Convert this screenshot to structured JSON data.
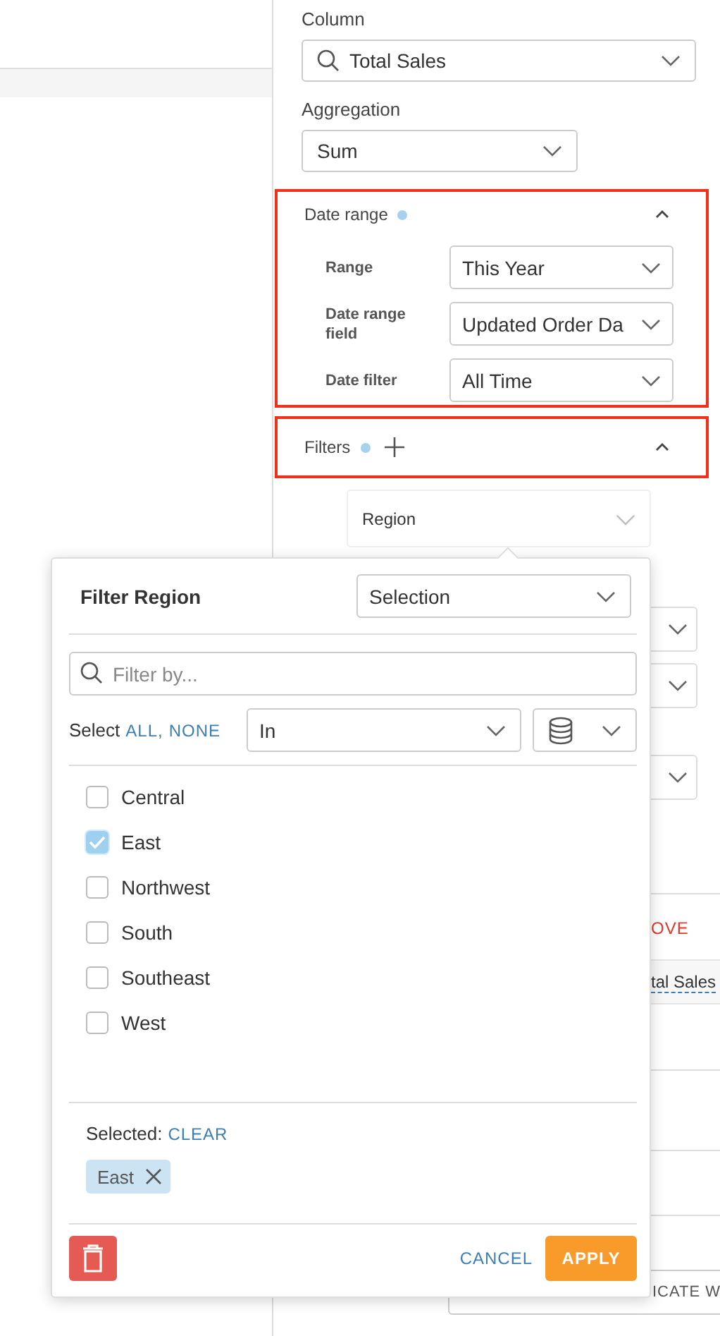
{
  "panel": {
    "column": {
      "label": "Column",
      "value": "Total Sales"
    },
    "aggregation": {
      "label": "Aggregation",
      "value": "Sum"
    },
    "date_range": {
      "title": "Date range",
      "highlighted": true,
      "has_value": true,
      "expanded": true,
      "fields": [
        {
          "label": "Range",
          "value": "This Year"
        },
        {
          "label": "Date range field",
          "value": "Updated Order Da"
        },
        {
          "label": "Date filter",
          "value": "All Time"
        }
      ]
    },
    "filters": {
      "title": "Filters",
      "highlighted": true,
      "has_value": true,
      "expanded": true,
      "items": [
        {
          "value": "Region"
        }
      ]
    },
    "remove_link": "OVE",
    "tooltip": "tal Sales",
    "duplicate_button": "ICATE W"
  },
  "popover": {
    "title": "Filter Region",
    "mode": "Selection",
    "search": {
      "placeholder": "Filter by..."
    },
    "select_label": "Select",
    "select_links": [
      "ALL,",
      "NONE"
    ],
    "operator": "In",
    "options": [
      {
        "label": "Central",
        "checked": false
      },
      {
        "label": "East",
        "checked": true
      },
      {
        "label": "Northwest",
        "checked": false
      },
      {
        "label": "South",
        "checked": false
      },
      {
        "label": "Southeast",
        "checked": false
      },
      {
        "label": "West",
        "checked": false
      }
    ],
    "selected_label": "Selected:",
    "clear": "CLEAR",
    "chips": [
      {
        "label": "East"
      }
    ],
    "cancel": "CANCEL",
    "apply": "APPLY"
  }
}
